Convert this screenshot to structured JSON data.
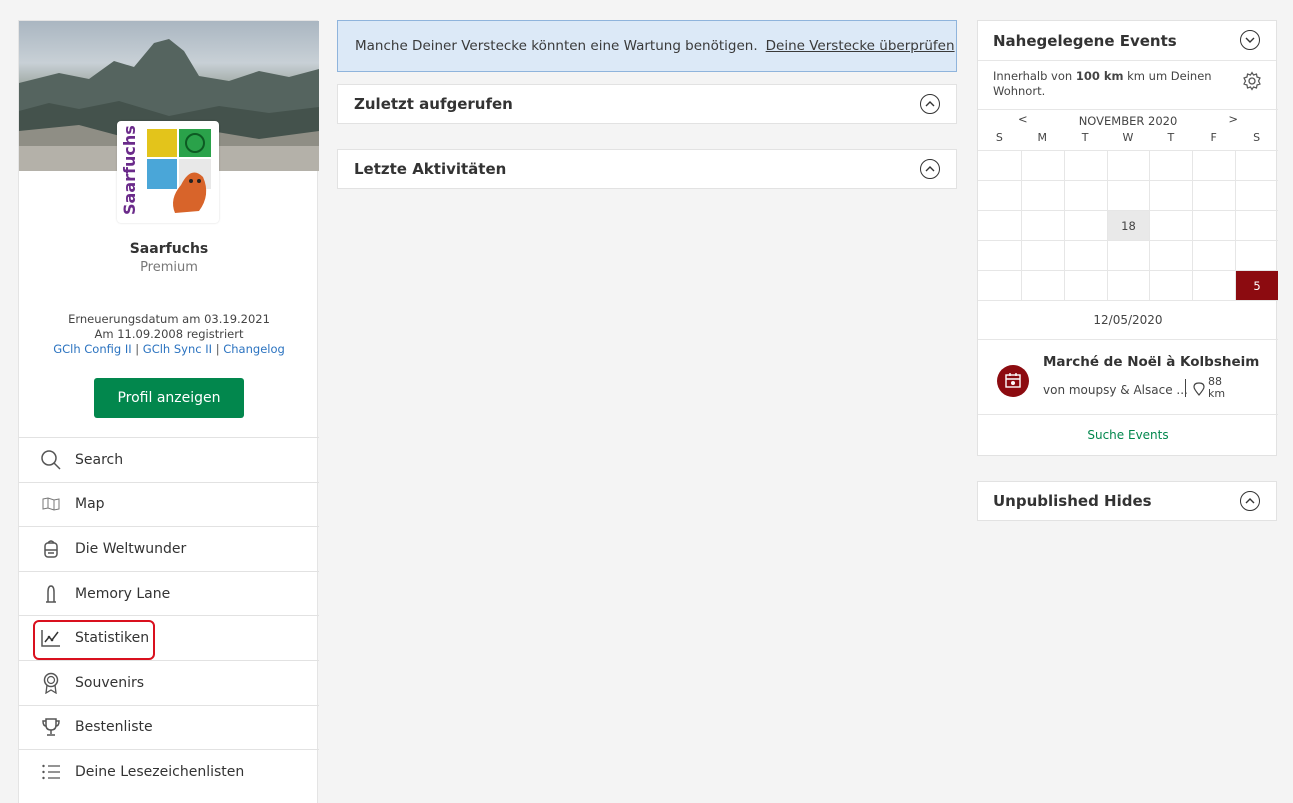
{
  "profile": {
    "name": "Saarfuchs",
    "membership": "Premium",
    "renewal": "Erneuerungsdatum am 03.19.2021",
    "registered": "Am 11.09.2008 registriert",
    "links": [
      "GClh Config II",
      "GClh Sync II",
      "Changelog"
    ],
    "avatar_text": "Saarfuchs",
    "view_profile_label": "Profil anzeigen"
  },
  "nav": {
    "items": [
      {
        "label": "Search",
        "icon": "search-icon"
      },
      {
        "label": "Map",
        "icon": "map-icon"
      },
      {
        "label": "Die Weltwunder",
        "icon": "backpack-icon"
      },
      {
        "label": "Memory Lane",
        "icon": "memory-lane-icon"
      },
      {
        "label": "Statistiken",
        "icon": "statistics-icon"
      },
      {
        "label": "Souvenirs",
        "icon": "souvenir-icon"
      },
      {
        "label": "Bestenliste",
        "icon": "trophy-icon"
      },
      {
        "label": "Deine Lesezeichenlisten",
        "icon": "list-icon"
      }
    ],
    "highlighted_index": 4
  },
  "alert": {
    "text": "Manche Deiner Verstecke könnten eine Wartung benötigen.",
    "link": "Deine Verstecke überprüfen"
  },
  "panels": {
    "recent": "Zuletzt aufgerufen",
    "activities": "Letzte Aktivitäten"
  },
  "events": {
    "title": "Nahegelegene Events",
    "radius_prefix": "Innerhalb von",
    "radius_value": "100 km",
    "radius_suffix": "km um Deinen Wohnort.",
    "month": "NOVEMBER 2020",
    "prev": "<",
    "next": ">",
    "weekdays": [
      "S",
      "M",
      "T",
      "W",
      "T",
      "F",
      "S"
    ],
    "calendar": [
      [
        "",
        "",
        "",
        "",
        "",
        "",
        ""
      ],
      [
        "",
        "",
        "",
        "",
        "",
        "",
        ""
      ],
      [
        "",
        "",
        "",
        "18",
        "",
        "",
        ""
      ],
      [
        "",
        "",
        "",
        "",
        "",
        "",
        ""
      ],
      [
        "",
        "",
        "",
        "",
        "",
        "",
        "5"
      ]
    ],
    "today_day": "18",
    "event_day": "5",
    "selected_date": "12/05/2020",
    "event_title": "Marché de Noël à Kolbsheim",
    "event_owner": "von moupsy & Alsace ...",
    "event_distance": "88",
    "event_distance_unit": "km",
    "search_label": "Suche Events"
  },
  "unpublished": {
    "title": "Unpublished Hides"
  },
  "colors": {
    "accent_green": "#02874d",
    "event_red": "#8c0b10",
    "highlight_red": "#d9101e",
    "link_blue": "#2b73c0",
    "alert_bg": "#dce9f7"
  }
}
